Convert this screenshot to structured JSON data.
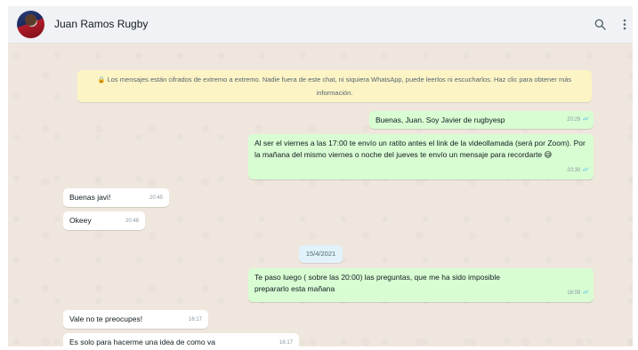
{
  "header": {
    "contact_name": "Juan Ramos Rugby",
    "avatar_icon": "contact-avatar",
    "search_icon": "search-icon",
    "menu_icon": "kebab-menu-icon"
  },
  "chat": {
    "encryption_notice": "Los mensajes están cifrados de extremo a extremo. Nadie fuera de este chat, ni siquiera WhatsApp, puede leerlos ni escucharlos. Haz clic para obtener más información.",
    "messages": [
      {
        "direction": "out",
        "text": "Buenas, Juan. Soy Javier de rugbyesp",
        "time": "20:29",
        "read": true
      },
      {
        "direction": "out",
        "text": "Al ser el viernes a las 17:00 te envío un ratito antes el link de la videollamada (será por Zoom). Por la mañana del mismo viernes o noche del jueves te envío un mensaje para recordarte 😅",
        "time": "20:30",
        "read": true
      },
      {
        "direction": "in",
        "text": "Buenas javi!",
        "time": "20:45"
      },
      {
        "direction": "in",
        "text": "Okeey",
        "time": "20:46"
      },
      {
        "direction": "out",
        "text": "Te paso luego ( sobre las 20:00) las preguntas, que me ha sido imposible prepararlo esta mañana",
        "time": "16:09",
        "read": true
      },
      {
        "direction": "in",
        "text": "Vale no te preocupes!",
        "time": "16:17"
      },
      {
        "direction": "in",
        "text": "Es solo para hacerme una idea de como va",
        "time": "16:17"
      }
    ],
    "date_separator": "15/4/2021"
  },
  "colors": {
    "header_bg": "#f0f2f5",
    "outgoing_bubble": "#d9fdd3",
    "incoming_bubble": "#ffffff",
    "notice_bg": "#fdf4c5",
    "read_ticks": "#53bdeb"
  }
}
